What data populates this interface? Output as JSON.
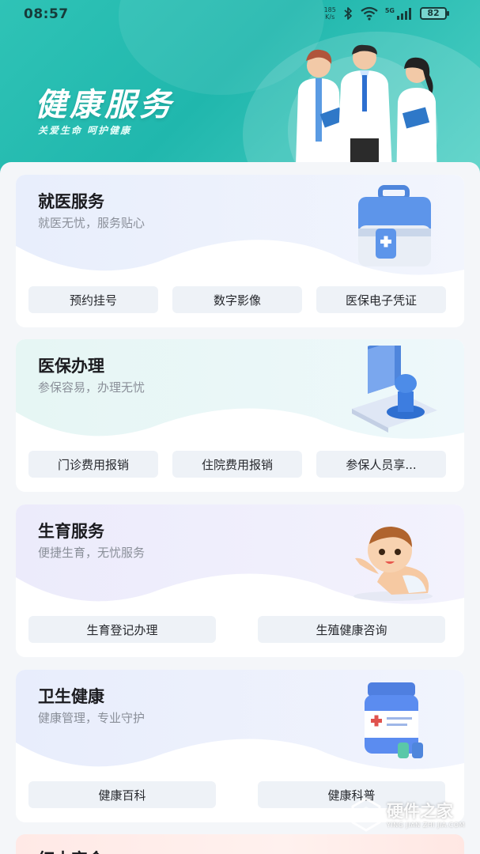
{
  "status_bar": {
    "time": "08:57",
    "net_speed_value": "185",
    "net_speed_unit": "K/s",
    "network": "5G",
    "battery": "82"
  },
  "hero": {
    "title": "健康服务",
    "subtitle": "关爱生命 呵护健康"
  },
  "cards": [
    {
      "title": "就医服务",
      "subtitle": "就医无忧，服务贴心",
      "art_icon": "first-aid-kit-icon",
      "buttons": [
        "预约挂号",
        "数字影像",
        "医保电子凭证"
      ]
    },
    {
      "title": "医保办理",
      "subtitle": "参保容易，办理无忧",
      "art_icon": "stamp-icon",
      "buttons": [
        "门诊费用报销",
        "住院费用报销",
        "参保人员享..."
      ]
    },
    {
      "title": "生育服务",
      "subtitle": "便捷生育，无忧服务",
      "art_icon": "baby-icon",
      "buttons": [
        "生育登记办理",
        "生殖健康咨询"
      ]
    },
    {
      "title": "卫生健康",
      "subtitle": "健康管理，专业守护",
      "art_icon": "medicine-bottle-icon",
      "buttons": [
        "健康百科",
        "健康科普"
      ]
    }
  ],
  "partial_card": {
    "title": "红十字会"
  },
  "watermark": {
    "text": "硬件之家",
    "subtext": "YING JIAN ZHI JIA.COM"
  },
  "colors": {
    "header": "#23b9ae",
    "button_bg": "#eef2f7",
    "title": "#1b1b1f",
    "subtitle": "#8a8f99"
  }
}
